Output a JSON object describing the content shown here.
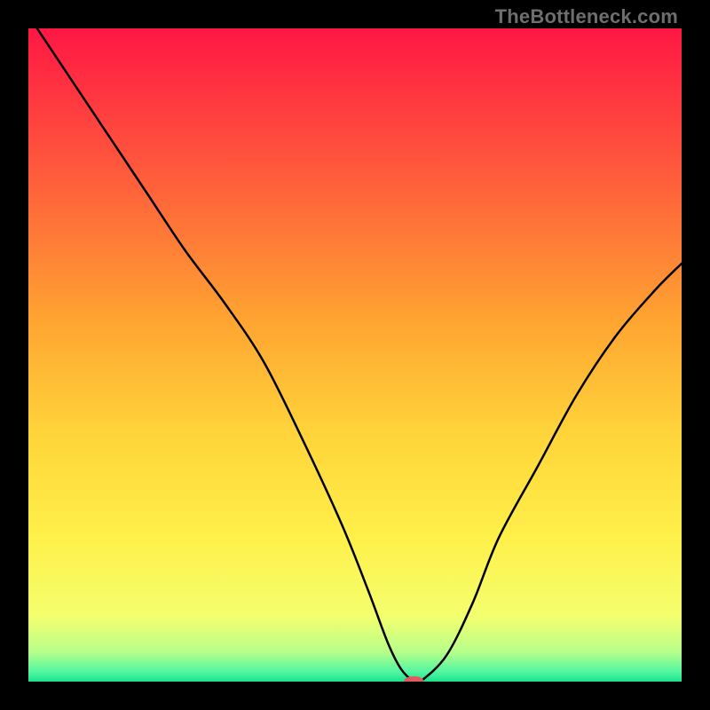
{
  "watermark": "TheBottleneck.com",
  "chart_data": {
    "type": "line",
    "title": "",
    "xlabel": "",
    "ylabel": "",
    "xlim": [
      0,
      100
    ],
    "ylim": [
      0,
      100
    ],
    "x": [
      0,
      6,
      12,
      18,
      24,
      30,
      36,
      42,
      48,
      52,
      55,
      57,
      59,
      60,
      64,
      68,
      72,
      78,
      84,
      90,
      96,
      100
    ],
    "values": [
      102,
      93,
      84,
      75,
      66,
      58,
      49,
      37,
      24,
      14,
      6,
      2,
      0,
      0,
      4,
      12,
      22,
      33,
      44,
      53,
      60,
      64
    ],
    "optimum_marker": {
      "x": 59,
      "y": 0,
      "color": "#e15a63",
      "rx": 11,
      "ry": 5
    },
    "gradient_stops": [
      {
        "offset": 0.0,
        "color": "#ff1744"
      },
      {
        "offset": 0.22,
        "color": "#ff5a3c"
      },
      {
        "offset": 0.45,
        "color": "#ffa531"
      },
      {
        "offset": 0.62,
        "color": "#ffd43a"
      },
      {
        "offset": 0.78,
        "color": "#fff04a"
      },
      {
        "offset": 0.9,
        "color": "#f4ff6e"
      },
      {
        "offset": 0.955,
        "color": "#b6ff8a"
      },
      {
        "offset": 0.985,
        "color": "#52f7a0"
      },
      {
        "offset": 1.0,
        "color": "#19e38c"
      }
    ]
  }
}
